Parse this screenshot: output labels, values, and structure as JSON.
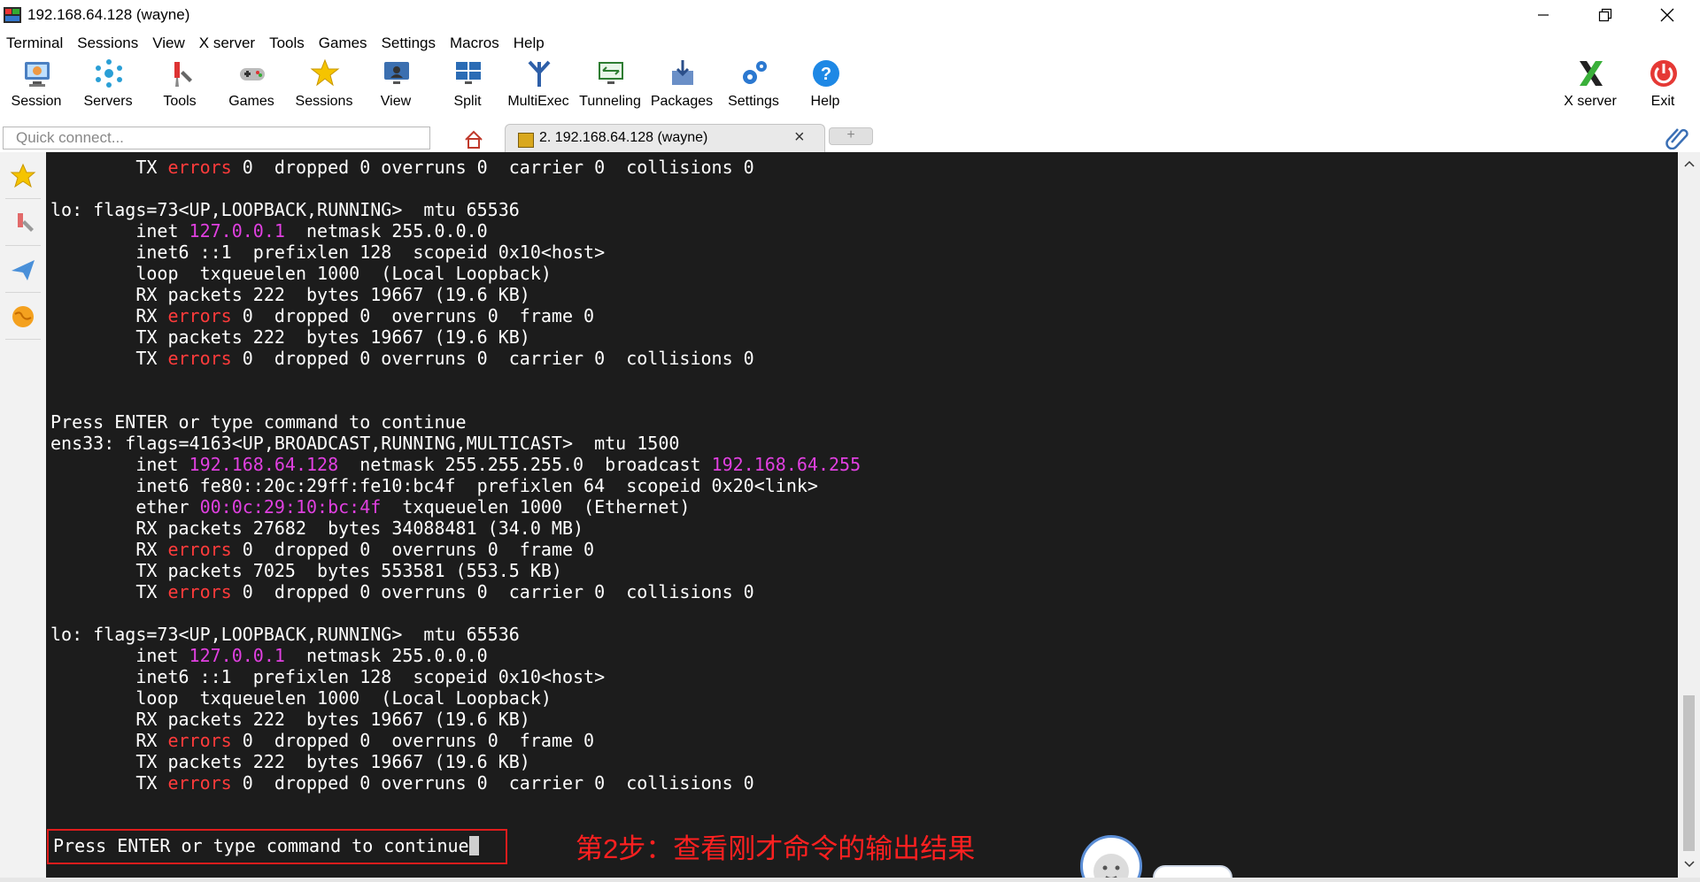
{
  "window": {
    "title": "192.168.64.128 (wayne)"
  },
  "menu": [
    "Terminal",
    "Sessions",
    "View",
    "X server",
    "Tools",
    "Games",
    "Settings",
    "Macros",
    "Help"
  ],
  "toolbar": {
    "buttons": [
      {
        "label": "Session",
        "icon": "session-monitor-icon"
      },
      {
        "label": "Servers",
        "icon": "servers-network-icon"
      },
      {
        "label": "Tools",
        "icon": "tools-wrench-icon"
      },
      {
        "label": "Games",
        "icon": "games-gamepad-icon"
      },
      {
        "label": "Sessions",
        "icon": "sessions-star-icon"
      },
      {
        "label": "View",
        "icon": "view-monitor-icon"
      },
      {
        "label": "Split",
        "icon": "split-window-icon"
      },
      {
        "label": "MultiExec",
        "icon": "multiexec-fork-icon"
      },
      {
        "label": "Tunneling",
        "icon": "tunneling-icon"
      },
      {
        "label": "Packages",
        "icon": "packages-icon"
      },
      {
        "label": "Settings",
        "icon": "settings-gears-icon"
      },
      {
        "label": "Help",
        "icon": "help-question-icon"
      }
    ],
    "xserver_label": "X server",
    "exit_label": "Exit"
  },
  "quick_connect": {
    "placeholder": "Quick connect..."
  },
  "active_tab": {
    "label": "2. 192.168.64.128 (wayne)"
  },
  "terminal": {
    "lines": [
      {
        "t": 0,
        "segments": [
          {
            "text": "        TX "
          },
          {
            "text": "errors",
            "c": "r"
          },
          {
            "text": " 0  dropped 0 overruns 0  carrier 0  collisions 0"
          }
        ]
      },
      {
        "t": 48,
        "segments": [
          {
            "text": "lo: flags=73<UP,LOOPBACK,RUNNING>  mtu 65536"
          }
        ]
      },
      {
        "t": 72,
        "segments": [
          {
            "text": "        inet "
          },
          {
            "text": "127.0.0.1",
            "c": "m"
          },
          {
            "text": "  netmask 255.0.0.0"
          }
        ]
      },
      {
        "t": 96,
        "segments": [
          {
            "text": "        inet6 ::1  prefixlen 128  scopeid 0x10<host>"
          }
        ]
      },
      {
        "t": 120,
        "segments": [
          {
            "text": "        loop  txqueuelen 1000  (Local Loopback)"
          }
        ]
      },
      {
        "t": 144,
        "segments": [
          {
            "text": "        RX packets 222  bytes 19667 (19.6 KB)"
          }
        ]
      },
      {
        "t": 168,
        "segments": [
          {
            "text": "        RX "
          },
          {
            "text": "errors",
            "c": "r"
          },
          {
            "text": " 0  dropped 0  overruns 0  frame 0"
          }
        ]
      },
      {
        "t": 192,
        "segments": [
          {
            "text": "        TX packets 222  bytes 19667 (19.6 KB)"
          }
        ]
      },
      {
        "t": 216,
        "segments": [
          {
            "text": "        TX "
          },
          {
            "text": "errors",
            "c": "r"
          },
          {
            "text": " 0  dropped 0 overruns 0  carrier 0  collisions 0"
          }
        ]
      },
      {
        "t": 288,
        "segments": [
          {
            "text": "Press ENTER or type command to continue"
          }
        ]
      },
      {
        "t": 312,
        "segments": [
          {
            "text": "ens33: flags=4163<UP,BROADCAST,RUNNING,MULTICAST>  mtu 1500"
          }
        ]
      },
      {
        "t": 336,
        "segments": [
          {
            "text": "        inet "
          },
          {
            "text": "192.168.64.128",
            "c": "m"
          },
          {
            "text": "  netmask 255.255.255.0  broadcast "
          },
          {
            "text": "192.168.64.255",
            "c": "m"
          }
        ]
      },
      {
        "t": 360,
        "segments": [
          {
            "text": "        inet6 fe80::20c:29ff:fe10:bc4f  prefixlen 64  scopeid 0x20<link>"
          }
        ]
      },
      {
        "t": 384,
        "segments": [
          {
            "text": "        ether "
          },
          {
            "text": "00:0c:29:10:bc:4f",
            "c": "m"
          },
          {
            "text": "  txqueuelen 1000  (Ethernet)"
          }
        ]
      },
      {
        "t": 408,
        "segments": [
          {
            "text": "        RX packets 27682  bytes 34088481 (34.0 MB)"
          }
        ]
      },
      {
        "t": 432,
        "segments": [
          {
            "text": "        RX "
          },
          {
            "text": "errors",
            "c": "r"
          },
          {
            "text": " 0  dropped 0  overruns 0  frame 0"
          }
        ]
      },
      {
        "t": 456,
        "segments": [
          {
            "text": "        TX packets 7025  bytes 553581 (553.5 KB)"
          }
        ]
      },
      {
        "t": 480,
        "segments": [
          {
            "text": "        TX "
          },
          {
            "text": "errors",
            "c": "r"
          },
          {
            "text": " 0  dropped 0 overruns 0  carrier 0  collisions 0"
          }
        ]
      },
      {
        "t": 528,
        "segments": [
          {
            "text": "lo: flags=73<UP,LOOPBACK,RUNNING>  mtu 65536"
          }
        ]
      },
      {
        "t": 552,
        "segments": [
          {
            "text": "        inet "
          },
          {
            "text": "127.0.0.1",
            "c": "m"
          },
          {
            "text": "  netmask 255.0.0.0"
          }
        ]
      },
      {
        "t": 576,
        "segments": [
          {
            "text": "        inet6 ::1  prefixlen 128  scopeid 0x10<host>"
          }
        ]
      },
      {
        "t": 600,
        "segments": [
          {
            "text": "        loop  txqueuelen 1000  (Local Loopback)"
          }
        ]
      },
      {
        "t": 624,
        "segments": [
          {
            "text": "        RX packets 222  bytes 19667 (19.6 KB)"
          }
        ]
      },
      {
        "t": 648,
        "segments": [
          {
            "text": "        RX "
          },
          {
            "text": "errors",
            "c": "r"
          },
          {
            "text": " 0  dropped 0  overruns 0  frame 0"
          }
        ]
      },
      {
        "t": 672,
        "segments": [
          {
            "text": "        TX packets 222  bytes 19667 (19.6 KB)"
          }
        ]
      },
      {
        "t": 696,
        "segments": [
          {
            "text": "        TX "
          },
          {
            "text": "errors",
            "c": "r"
          },
          {
            "text": " 0  dropped 0 overruns 0  carrier 0  collisions 0"
          }
        ]
      }
    ],
    "prompt": "Press ENTER or type command to continue",
    "annotation": "第2步：查看刚才命令的输出结果"
  },
  "colors": {
    "terminal_bg": "#1c1c1c",
    "ip_magenta": "#e040e0",
    "error_red": "#ff3b3b",
    "annotation_red": "#ff2020"
  }
}
